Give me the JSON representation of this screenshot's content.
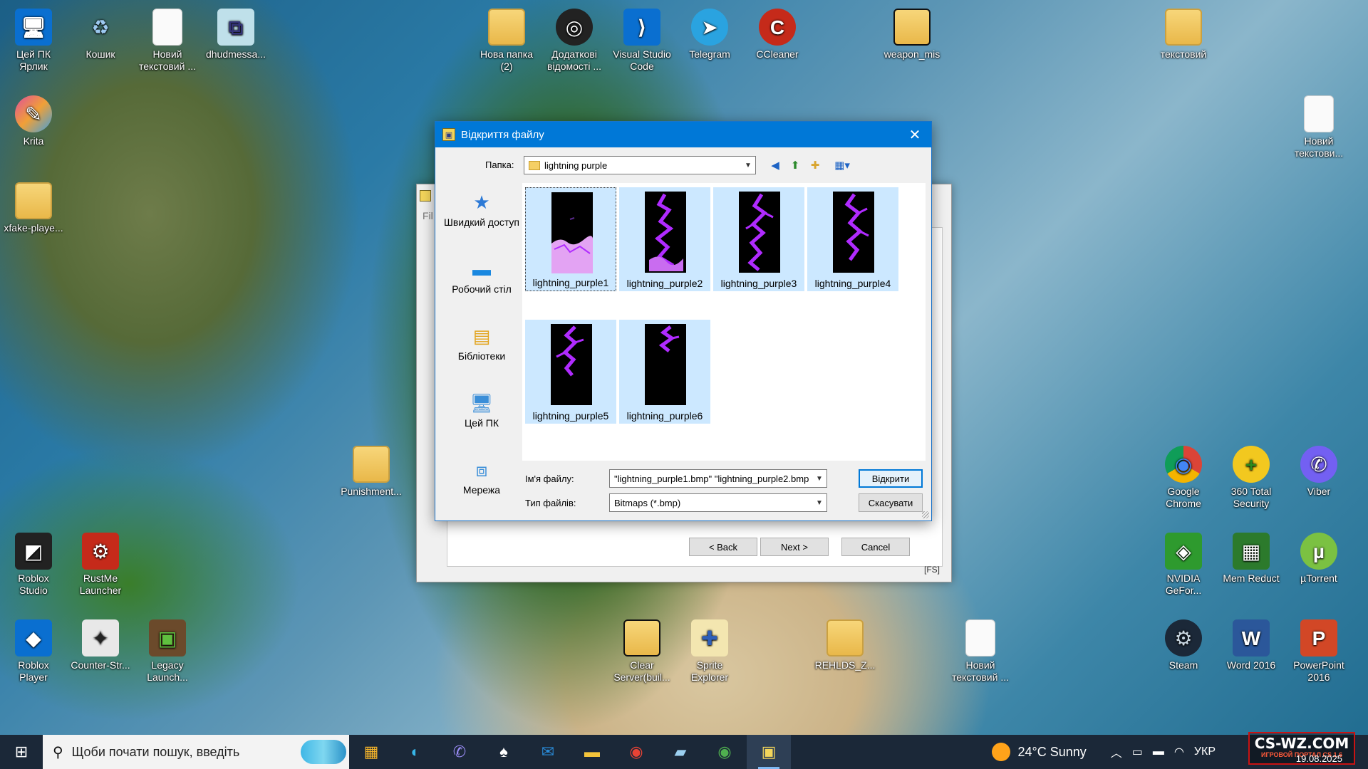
{
  "desktop": {
    "icons": [
      {
        "id": "this-pc-shortcut",
        "label": "Цей ПК Ярлик",
        "glyph": "🖥"
      },
      {
        "id": "recycle-bin",
        "label": "Кошик",
        "glyph": "♻"
      },
      {
        "id": "new-text-doc-1",
        "label": "Новий текстовий ...",
        "glyph": ""
      },
      {
        "id": "dhudmessage",
        "label": "dhudmessa...",
        "glyph": "⧉"
      },
      {
        "id": "krita",
        "label": "Krita",
        "glyph": "✎"
      },
      {
        "id": "xfake-player",
        "label": "xfake-playe...",
        "glyph": ""
      },
      {
        "id": "new-folder-2",
        "label": "Нова папка (2)",
        "glyph": ""
      },
      {
        "id": "additional-info",
        "label": "Додаткові відомості ...",
        "glyph": "◎"
      },
      {
        "id": "vscode",
        "label": "Visual Studio Code",
        "glyph": "⟩"
      },
      {
        "id": "telegram",
        "label": "Telegram",
        "glyph": "➤"
      },
      {
        "id": "ccleaner",
        "label": "CCleaner",
        "glyph": "C"
      },
      {
        "id": "weapon-mis",
        "label": "weapon_mis",
        "glyph": ""
      },
      {
        "id": "text-folder",
        "label": "текстовий",
        "glyph": ""
      },
      {
        "id": "new-text-doc-2",
        "label": "Новий текстови...",
        "glyph": ""
      },
      {
        "id": "punishment",
        "label": "Punishment...",
        "glyph": ""
      },
      {
        "id": "google-chrome",
        "label": "Google Chrome",
        "glyph": "◉"
      },
      {
        "id": "360-total",
        "label": "360 Total Security",
        "glyph": "+"
      },
      {
        "id": "viber",
        "label": "Viber",
        "glyph": "✆"
      },
      {
        "id": "roblox-studio",
        "label": "Roblox Studio",
        "glyph": "◩"
      },
      {
        "id": "rustme",
        "label": "RustMe Launcher",
        "glyph": "⚙"
      },
      {
        "id": "nvidia",
        "label": "NVIDIA GeFor...",
        "glyph": "◈"
      },
      {
        "id": "mem-reduct",
        "label": "Mem Reduct",
        "glyph": "▦"
      },
      {
        "id": "utorrent",
        "label": "µTorrent",
        "glyph": "µ"
      },
      {
        "id": "roblox-player",
        "label": "Roblox Player",
        "glyph": "◆"
      },
      {
        "id": "counter-strike",
        "label": "Counter-Str...",
        "glyph": "✦"
      },
      {
        "id": "legacy-launcher",
        "label": "Legacy Launch...",
        "glyph": "▣"
      },
      {
        "id": "clear-server",
        "label": "Clear Server(buil...",
        "glyph": ""
      },
      {
        "id": "sprite-explorer",
        "label": "Sprite Explorer",
        "glyph": "✚"
      },
      {
        "id": "rehlds",
        "label": "REHLDS_Z...",
        "glyph": ""
      },
      {
        "id": "new-text-doc-3",
        "label": "Новий текстовий ...",
        "glyph": ""
      },
      {
        "id": "steam",
        "label": "Steam",
        "glyph": "⚙"
      },
      {
        "id": "word",
        "label": "Word 2016",
        "glyph": "W"
      },
      {
        "id": "powerpoint",
        "label": "PowerPoint 2016",
        "glyph": "P"
      }
    ]
  },
  "background_window": {
    "title_fragment": "Fil",
    "buttons": {
      "back": "< Back",
      "next": "Next >",
      "cancel": "Cancel"
    },
    "tag": "[FS]"
  },
  "dialog": {
    "title": "Відкриття файлу",
    "folder_label": "Папка:",
    "folder_value": "lightning purple",
    "places": [
      {
        "label": "Швидкий доступ",
        "icon": "star-icon",
        "glyph": "★"
      },
      {
        "label": "Робочий стіл",
        "icon": "desktop-icon",
        "glyph": "▬"
      },
      {
        "label": "Бібліотеки",
        "icon": "libraries-icon",
        "glyph": "▤"
      },
      {
        "label": "Цей ПК",
        "icon": "computer-icon",
        "glyph": "🖥"
      },
      {
        "label": "Мережа",
        "icon": "network-icon",
        "glyph": "⧈"
      }
    ],
    "files": [
      {
        "name": "lightning_purple1"
      },
      {
        "name": "lightning_purple2"
      },
      {
        "name": "lightning_purple3"
      },
      {
        "name": "lightning_purple4"
      },
      {
        "name": "lightning_purple5"
      },
      {
        "name": "lightning_purple6"
      }
    ],
    "filename_label": "Ім'я файлу:",
    "filename_value": "\"lightning_purple1.bmp\" \"lightning_purple2.bmp",
    "filetype_label": "Тип файлів:",
    "filetype_value": "Bitmaps (*.bmp)",
    "open_button": "Відкрити",
    "cancel_button": "Скасувати"
  },
  "taskbar": {
    "search_placeholder": "Щоби почати пошук, введіть",
    "weather": "24°C  Sunny",
    "language": "УКР",
    "date": "19.08.2025"
  },
  "watermark": {
    "line1": "CS-WZ.COM",
    "line2": "ИГРОВОЙ ПОРТАЛ CS 1.6"
  },
  "colors": {
    "accent": "#0078d7",
    "selection": "#cce8ff",
    "lightning": "#b02bff",
    "taskbar": "#1b2838"
  }
}
